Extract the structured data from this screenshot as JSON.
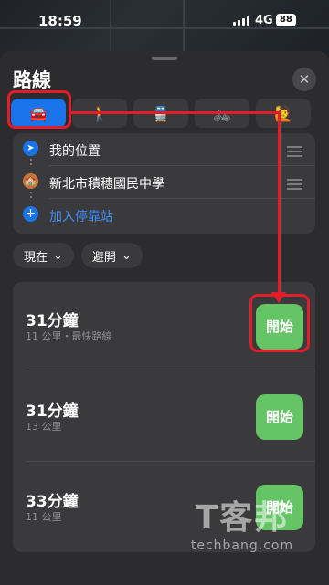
{
  "status_bar": {
    "time": "18:59",
    "network": "4G",
    "battery": "88"
  },
  "sheet": {
    "title": "路線"
  },
  "modes": [
    {
      "name": "drive",
      "icon": "car-icon",
      "glyph": "🚘"
    },
    {
      "name": "walk",
      "icon": "walk-icon",
      "glyph": "🚶"
    },
    {
      "name": "transit",
      "icon": "train-icon",
      "glyph": "🚆"
    },
    {
      "name": "cycle",
      "icon": "bike-icon",
      "glyph": "🚲"
    },
    {
      "name": "rideshare",
      "icon": "hail-icon",
      "glyph": "🙋"
    }
  ],
  "stops": [
    {
      "label": "我的位置"
    },
    {
      "label": "新北市積穗國民中學"
    },
    {
      "label": "加入停靠站"
    }
  ],
  "filters": {
    "time": "現在",
    "avoid": "避開"
  },
  "routes": [
    {
      "duration": "31分鐘",
      "detail": "11 公里・最快路線",
      "go": "開始"
    },
    {
      "duration": "31分鐘",
      "detail": "13 公里",
      "go": "開始"
    },
    {
      "duration": "33分鐘",
      "detail": "11 公里",
      "go": "開始"
    }
  ],
  "watermark": {
    "big": "T客邦",
    "small": "techbang.com"
  },
  "colors": {
    "accent": "#1a73e8",
    "go": "#65c466",
    "annotation": "#e11d2a"
  }
}
